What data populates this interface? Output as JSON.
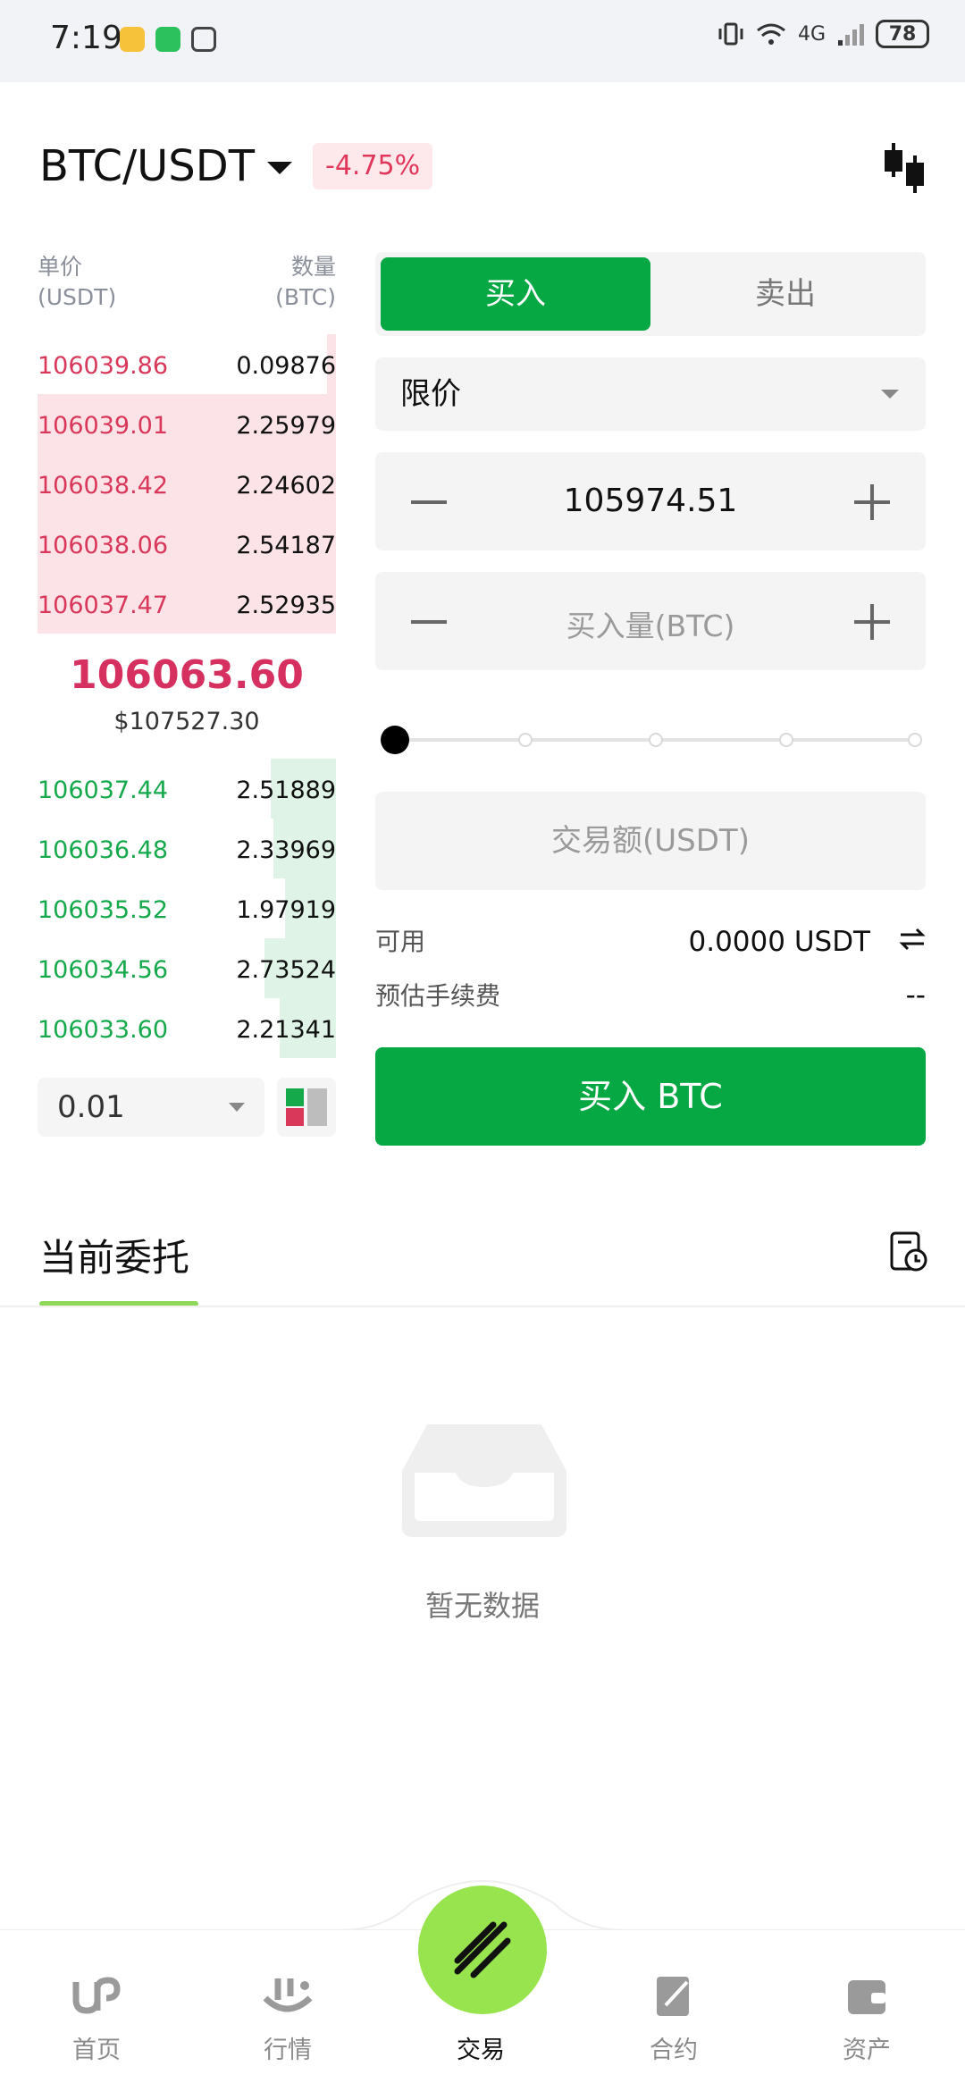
{
  "status_bar": {
    "time": "7:19",
    "battery": "78",
    "network": "4G"
  },
  "header": {
    "pair": "BTC/USDT",
    "change": "-4.75%",
    "change_color": "#e0375a",
    "chart_icon": "candlestick-icon"
  },
  "orderbook": {
    "price_header": "单价",
    "price_unit": "(USDT)",
    "qty_header": "数量",
    "qty_unit": "(BTC)",
    "asks": [
      {
        "price": "106039.86",
        "qty": "0.09876",
        "depth": 0.03
      },
      {
        "price": "106039.01",
        "qty": "2.25979",
        "depth": 1.0
      },
      {
        "price": "106038.42",
        "qty": "2.24602",
        "depth": 1.0
      },
      {
        "price": "106038.06",
        "qty": "2.54187",
        "depth": 1.0
      },
      {
        "price": "106037.47",
        "qty": "2.52935",
        "depth": 1.0
      }
    ],
    "last_price": "106063.60",
    "last_price_fiat": "$107527.30",
    "bids": [
      {
        "price": "106037.44",
        "qty": "2.51889",
        "depth": 0.22
      },
      {
        "price": "106036.48",
        "qty": "2.33969",
        "depth": 0.21
      },
      {
        "price": "106035.52",
        "qty": "1.97919",
        "depth": 0.17
      },
      {
        "price": "106034.56",
        "qty": "2.73524",
        "depth": 0.24
      },
      {
        "price": "106033.60",
        "qty": "2.21341",
        "depth": 0.19
      }
    ],
    "precision": "0.01",
    "ask_color": "#d9385a",
    "bid_color": "#15a94c"
  },
  "trade_form": {
    "buy_tab": "买入",
    "sell_tab": "卖出",
    "order_type": "限价",
    "price_value": "105974.51",
    "amount_placeholder": "买入量(BTC)",
    "slider_percent": 0,
    "total_placeholder": "交易额(USDT)",
    "available_label": "可用",
    "available_value": "0.0000 USDT",
    "fee_label": "预估手续费",
    "fee_value": "--",
    "submit_label": "买入 BTC",
    "accent": "#05a843"
  },
  "orders": {
    "tab_label": "当前委托",
    "empty_text": "暂无数据"
  },
  "bottom_nav": {
    "items": [
      {
        "label": "首页",
        "icon": "home-icon"
      },
      {
        "label": "行情",
        "icon": "market-icon"
      },
      {
        "label": "交易",
        "icon": "trade-icon"
      },
      {
        "label": "合约",
        "icon": "contract-icon"
      },
      {
        "label": "资产",
        "icon": "wallet-icon"
      }
    ],
    "active_index": 2
  }
}
